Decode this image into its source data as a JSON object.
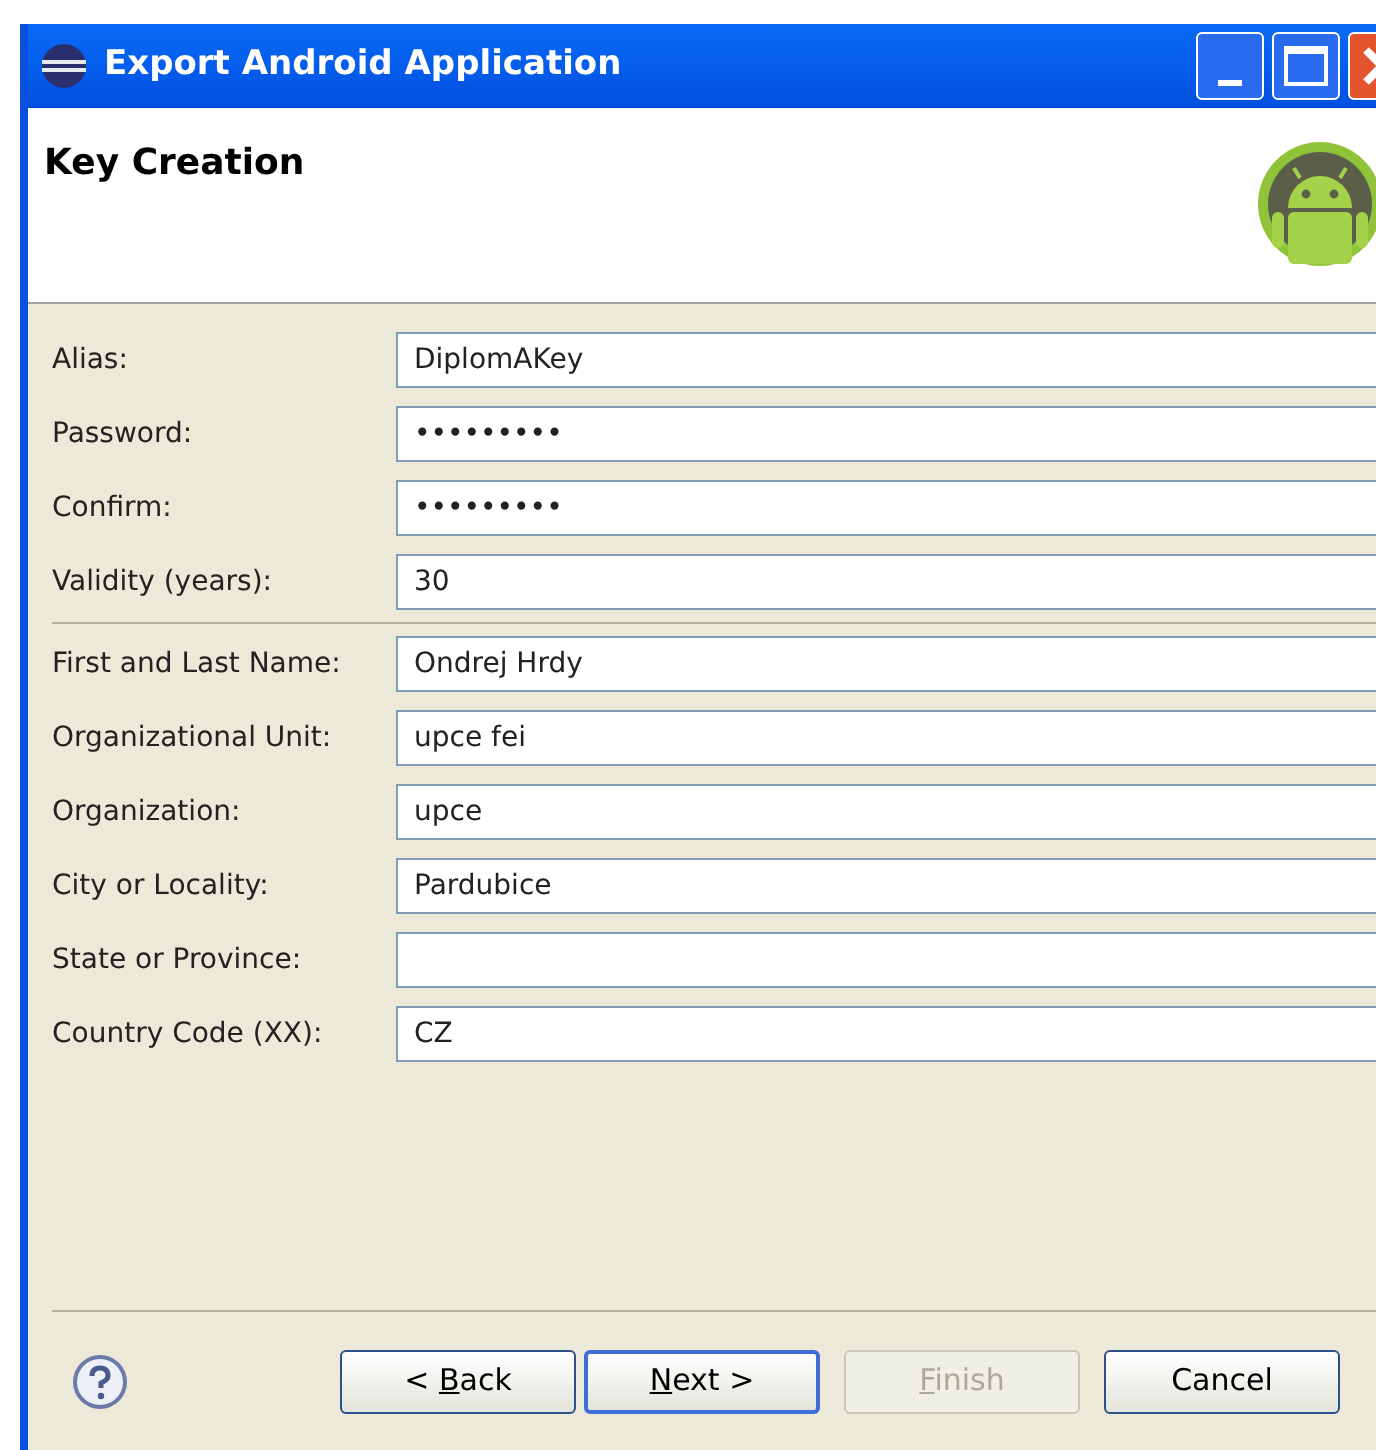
{
  "window": {
    "title": "Export Android Application"
  },
  "header": {
    "title": "Key Creation"
  },
  "field_groups": [
    {
      "fields": [
        {
          "label": "Alias:",
          "value": "DiplomAKey"
        },
        {
          "label": "Password:",
          "value": "•••••••••"
        },
        {
          "label": "Confirm:",
          "value": "•••••••••"
        },
        {
          "label": "Validity (years):",
          "value": "30"
        }
      ]
    },
    {
      "fields": [
        {
          "label": "First and Last Name:",
          "value": "Ondrej Hrdy"
        },
        {
          "label": "Organizational Unit:",
          "value": "upce fei"
        },
        {
          "label": "Organization:",
          "value": "upce"
        },
        {
          "label": "City or Locality:",
          "value": "Pardubice"
        },
        {
          "label": "State or Province:"
        },
        {
          "label": "Country Code (XX):",
          "value": "CZ"
        }
      ]
    }
  ],
  "buttons": [
    {
      "text_before": "< ",
      "mnemonic": "B",
      "text_after": "ack",
      "disabled": false,
      "selected": false
    },
    {
      "mnemonic": "N",
      "text_after": "ext >",
      "disabled": false,
      "selected": true
    },
    {
      "mnemonic": "F",
      "text_after": "inish",
      "disabled": true,
      "selected": false
    },
    {
      "text_after": "Cancel",
      "disabled": false,
      "selected": false
    }
  ]
}
